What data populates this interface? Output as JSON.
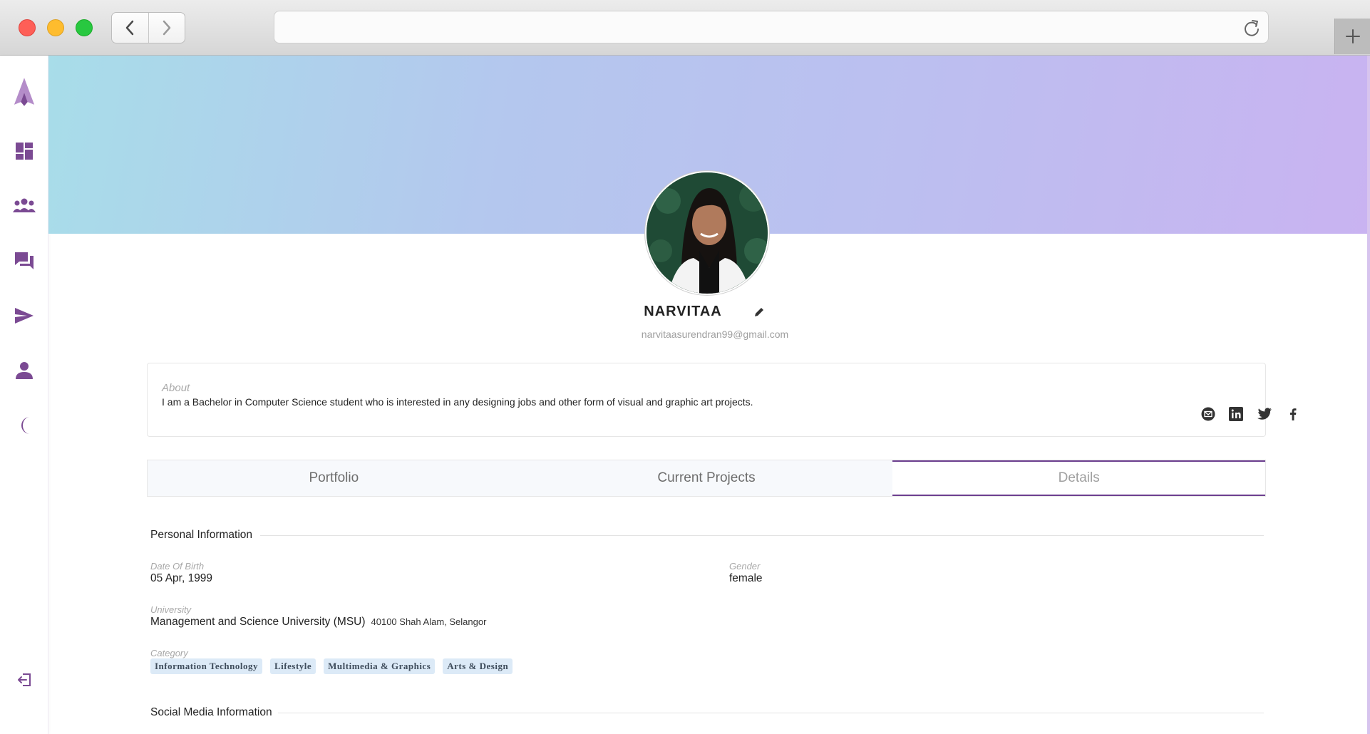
{
  "browser": {
    "url": ""
  },
  "sidebar": {
    "items": [
      {
        "icon": "logo-icon"
      },
      {
        "icon": "dashboard-icon"
      },
      {
        "icon": "group-icon"
      },
      {
        "icon": "forum-icon"
      },
      {
        "icon": "send-icon"
      },
      {
        "icon": "person-icon"
      },
      {
        "icon": "moon-icon"
      },
      {
        "icon": "logout-icon"
      }
    ],
    "accent": "#7b4a93"
  },
  "profile": {
    "name": "NARVITAA",
    "email": "narvitaasurendran99@gmail.com"
  },
  "about": {
    "label": "About",
    "text": "I am a Bachelor in Computer Science student who is interested in any designing jobs and other form of visual and graphic art projects.",
    "social_icons": [
      "email-icon",
      "linkedin-icon",
      "twitter-icon",
      "facebook-icon"
    ]
  },
  "tabs": [
    {
      "label": "Portfolio",
      "active": false
    },
    {
      "label": "Current Projects",
      "active": false
    },
    {
      "label": "Details",
      "active": true
    }
  ],
  "details": {
    "personal_heading": "Personal Information",
    "dob_label": "Date Of Birth",
    "dob_value": "05 Apr, 1999",
    "gender_label": "Gender",
    "gender_value": "female",
    "university_label": "University",
    "university_value": "Management and Science University (MSU)",
    "university_location": "40100 Shah Alam, Selangor",
    "category_label": "Category",
    "categories": [
      "Information Technology",
      "Lifestyle",
      "Multimedia & Graphics",
      "Arts & Design"
    ],
    "social_heading": "Social Media Information"
  }
}
